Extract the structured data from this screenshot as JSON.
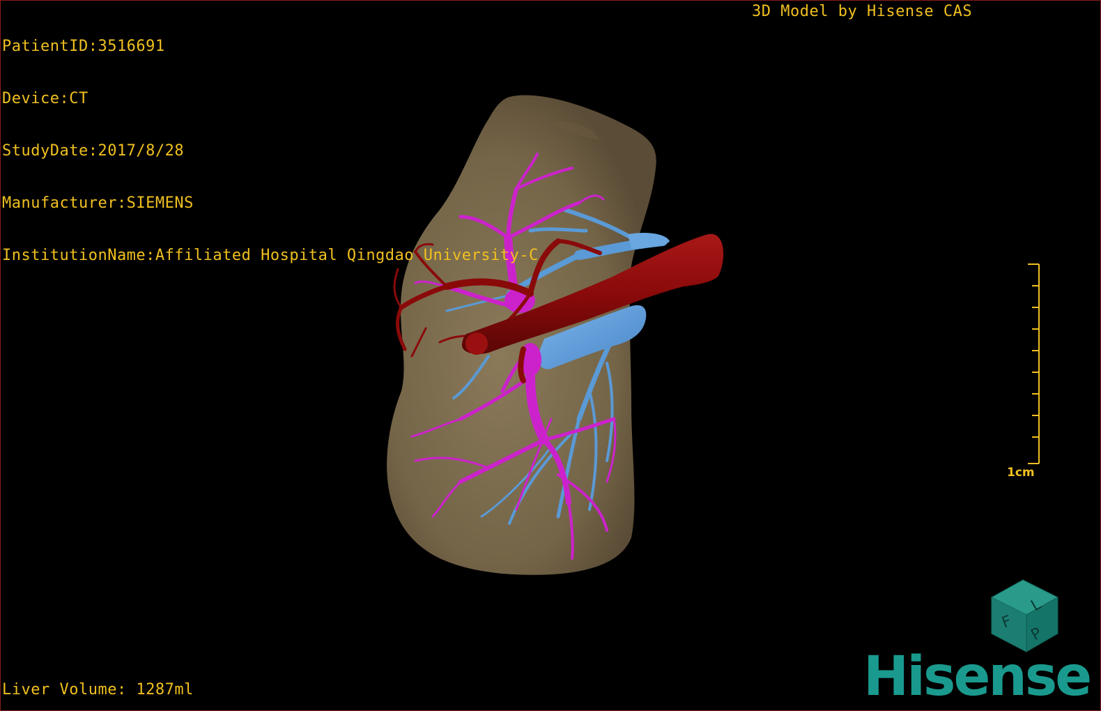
{
  "patient_info": {
    "patient_id": "PatientID:3516691",
    "device": "Device:CT",
    "study_date": "StudyDate:2017/8/28",
    "manufacturer": "Manufacturer:SIEMENS",
    "institution": "InstitutionName:Affiliated Hospital Qingdao University-C"
  },
  "credit": "3D Model by Hisense CAS",
  "liver_volume": "Liver Volume: 1287ml",
  "scale": {
    "label": "1cm"
  },
  "orientation_cube": {
    "face_front": "F",
    "face_side": "L",
    "face_bottom": "P"
  },
  "logo": {
    "text": "Hisense"
  },
  "colors": {
    "overlay_text": "#f0c020",
    "liver": "#7a6a4e",
    "hepatic_artery": "#8a0a0a",
    "portal_vein": "#cc22cc",
    "hepatic_vein": "#5a9ad6",
    "logo": "#1a9a8e",
    "border": "#8a1d1d"
  }
}
